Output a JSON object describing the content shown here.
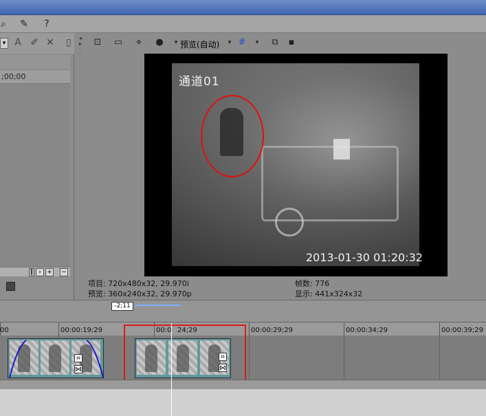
{
  "preview_toolbar": {
    "quality_label": "预览(自动)"
  },
  "left_panel": {
    "timecode": ";00;00"
  },
  "video": {
    "camera_label": "通道01",
    "timestamp": "2013-01-30 01:20:32"
  },
  "info": {
    "project_label": "项目: 720x480x32, 29.970i",
    "preview_label": "预览: 360x240x32, 29.970p",
    "frames_label": "帧数: 776",
    "display_label": "显示: 441x324x32"
  },
  "timeline": {
    "cursor_timecode": "-2;11",
    "ruler": [
      "00",
      "00:00:19;29",
      "00:0",
      "24;29",
      "00:00:29;29",
      "00:00:34;29",
      "00:00:39;29"
    ]
  },
  "icons": {
    "toolbar": [
      "zoom-icon",
      "brush-icon",
      "help-pointer-icon"
    ],
    "left": [
      "dropdown-icon",
      "ai-icon",
      "pin-icon",
      "close-icon",
      "copy-icon"
    ],
    "preview": [
      "split-screen-icon",
      "monitor-icon",
      "overlay-icon",
      "circle-icon",
      "grid-icon",
      "copy-frame-icon",
      "save-frame-icon"
    ]
  },
  "colors": {
    "highlight": "#e01818",
    "clip": "#5f9a9e",
    "cursor_line": "#7ab0ff"
  }
}
